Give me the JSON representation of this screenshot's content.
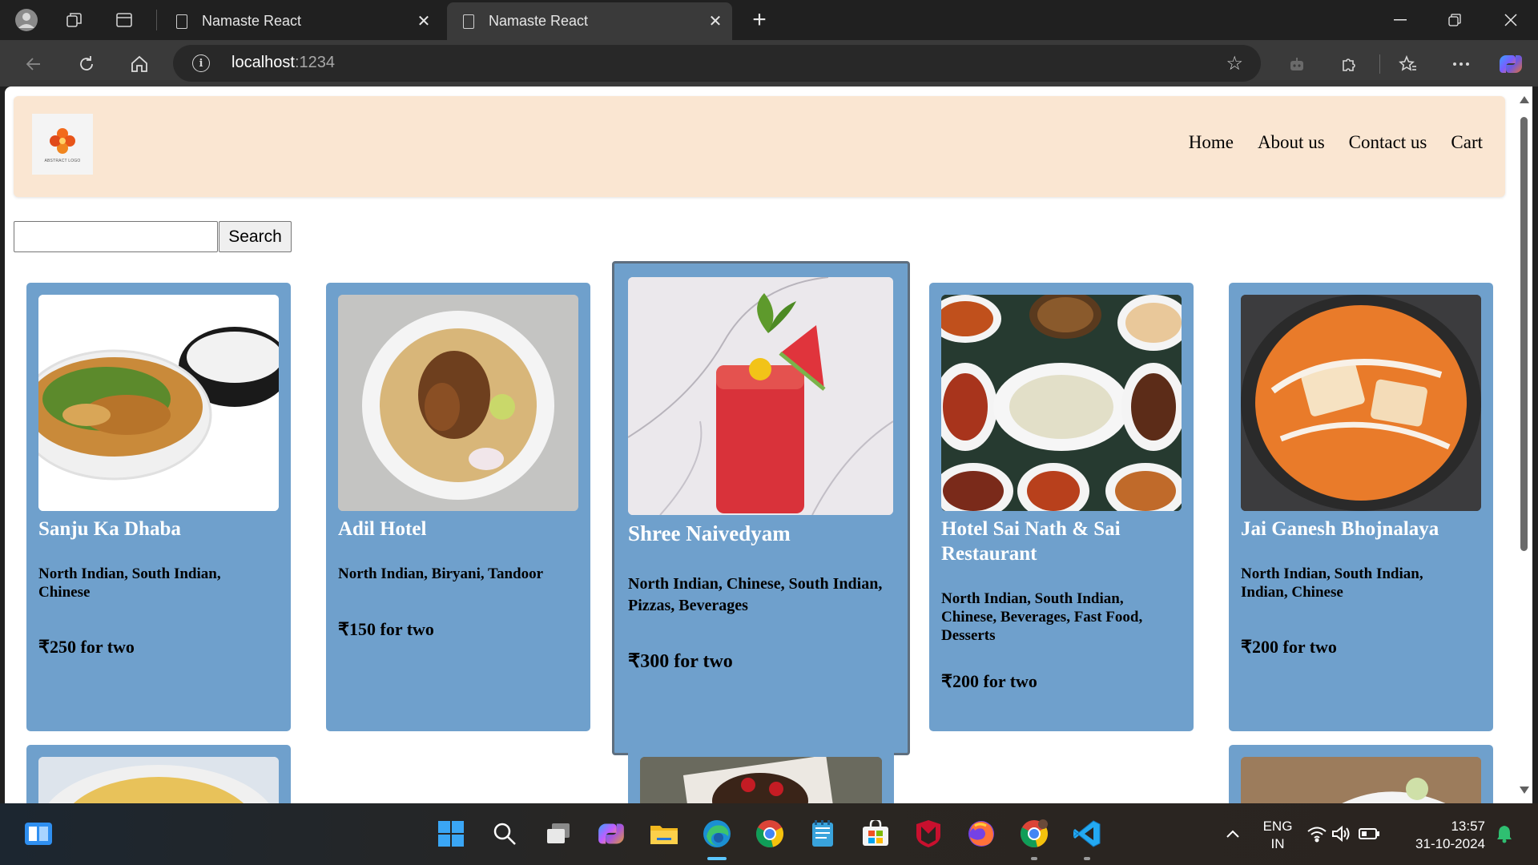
{
  "browser": {
    "tabs": [
      {
        "title": "Namaste React",
        "active": false
      },
      {
        "title": "Namaste React",
        "active": true
      }
    ],
    "url_host": "localhost",
    "url_port": ":1234"
  },
  "header": {
    "logo_text": "ABSTRACT LOGO",
    "nav": [
      "Home",
      "About us",
      "Contact us",
      "Cart"
    ]
  },
  "search": {
    "value": "",
    "button_label": "Search"
  },
  "restaurants": [
    {
      "name": "Sanju Ka Dhaba",
      "cuisines": "North Indian, South Indian, Chinese",
      "price": "₹250 for two"
    },
    {
      "name": "Adil Hotel",
      "cuisines": "North Indian, Biryani, Tandoor",
      "price": "₹150 for two"
    },
    {
      "name": "Shree Naivedyam",
      "cuisines": "North Indian, Chinese, South Indian, Pizzas, Beverages",
      "price": "₹300 for two"
    },
    {
      "name": "Hotel Sai Nath & Sai Restaurant",
      "cuisines": "North Indian, South Indian, Chinese, Beverages, Fast Food, Desserts",
      "price": "₹200 for two"
    },
    {
      "name": "Jai Ganesh Bhojnalaya",
      "cuisines": "North Indian, South Indian, Indian, Chinese",
      "price": "₹200 for two"
    }
  ],
  "taskbar": {
    "lang_line1": "ENG",
    "lang_line2": "IN",
    "time": "13:57",
    "date": "31-10-2024"
  },
  "colors": {
    "header_bg": "#fae6d2",
    "card_bg": "#6fa0cc",
    "chrome_bg": "#202020"
  }
}
